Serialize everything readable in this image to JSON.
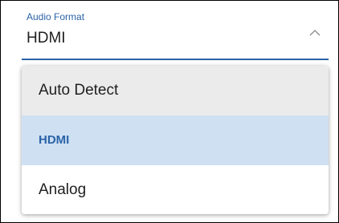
{
  "select": {
    "label": "Audio Format",
    "value": "HDMI",
    "chevron_icon": "chevron-up-icon",
    "expanded": true
  },
  "menu": {
    "options": [
      {
        "label": "Auto Detect",
        "state": "hover"
      },
      {
        "label": "HDMI",
        "state": "selected"
      },
      {
        "label": "Analog",
        "state": "normal"
      }
    ]
  },
  "colors": {
    "accent": "#2b63a8",
    "selected_background": "#cfe0f3",
    "hover_background": "#ebebeb",
    "text": "#1f1f1f"
  }
}
